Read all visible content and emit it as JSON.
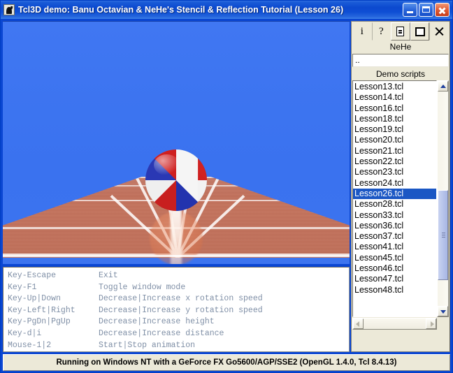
{
  "window": {
    "title": "Tcl3D demo: Banu Octavian & NeHe's Stencil & Reflection Tutorial (Lesson 26)",
    "app_icon": "tcl3d-icon",
    "minimize_label": "",
    "maximize_label": "",
    "close_label": ""
  },
  "toolbar": {
    "info_label": "i",
    "help_label": "?",
    "doc_label": "",
    "window_label": "",
    "close_label": ""
  },
  "panel": {
    "group_label": "NeHe",
    "path_value": "..",
    "path_placeholder": "..",
    "scripts_label": "Demo scripts"
  },
  "scripts": {
    "selected": "Lesson26.tcl",
    "items": [
      "Lesson13.tcl",
      "Lesson14.tcl",
      "Lesson16.tcl",
      "Lesson18.tcl",
      "Lesson19.tcl",
      "Lesson20.tcl",
      "Lesson21.tcl",
      "Lesson22.tcl",
      "Lesson23.tcl",
      "Lesson24.tcl",
      "Lesson26.tcl",
      "Lesson28.tcl",
      "Lesson33.tcl",
      "Lesson36.tcl",
      "Lesson37.tcl",
      "Lesson41.tcl",
      "Lesson45.tcl",
      "Lesson46.tcl",
      "Lesson47.tcl",
      "Lesson48.tcl"
    ]
  },
  "keybindings": {
    "rows": [
      {
        "key": "Key-Escape",
        "action": "Exit"
      },
      {
        "key": "Key-F1",
        "action": "Toggle window mode"
      },
      {
        "key": "Key-Up|Down",
        "action": "Decrease|Increase x rotation speed"
      },
      {
        "key": "Key-Left|Right",
        "action": "Decrease|Increase y rotation speed"
      },
      {
        "key": "Key-PgDn|PgUp",
        "action": "Decrease|Increase height"
      },
      {
        "key": "Key-d|i",
        "action": "Decrease|Increase distance"
      },
      {
        "key": "Mouse-1|2",
        "action": "Start|Stop animation"
      }
    ]
  },
  "statusbar": {
    "text": "Running on Windows NT with a GeForce FX Go5600/AGP/SSE2 (OpenGL 1.4.0, Tcl 8.4.13)"
  },
  "scene": {
    "description": "Stencil reflection demo: striped beach ball above a reflective tiled floor",
    "sky_color": "#3a72ef",
    "floor_color": "#c0705a",
    "grid_color": "#ffffff",
    "ball_colors": [
      "#c41f20",
      "#ffffff",
      "#1f2ba8"
    ]
  }
}
